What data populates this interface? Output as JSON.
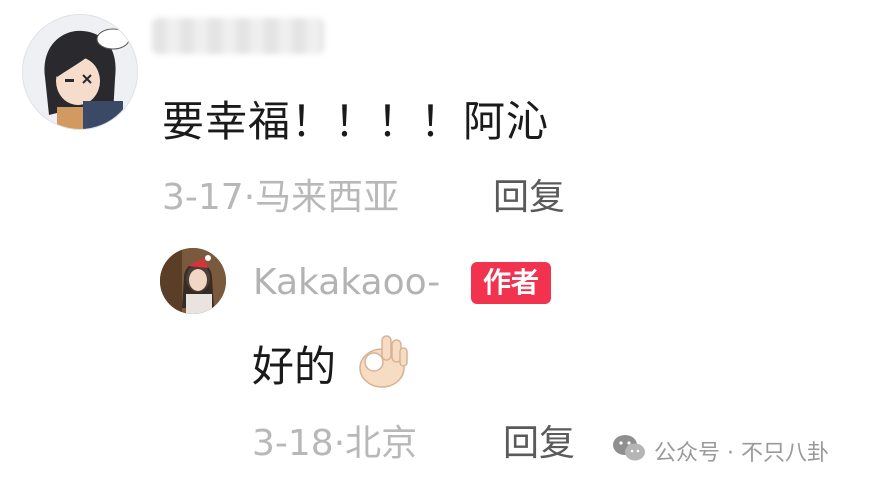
{
  "comment": {
    "text": "要幸福！！！！阿沁",
    "date": "3-17",
    "location": "马来西亚",
    "reply_label": "回复"
  },
  "reply": {
    "username": "Kakakaoo-",
    "badge": "作者",
    "text": "好的",
    "date": "3-18",
    "location": "北京",
    "reply_label": "回复"
  },
  "watermark": {
    "text": "公众号 · 不只八卦"
  },
  "colors": {
    "badge": "#f2334f",
    "meta": "#b8b8b8",
    "body_text": "#1a1a1a"
  }
}
